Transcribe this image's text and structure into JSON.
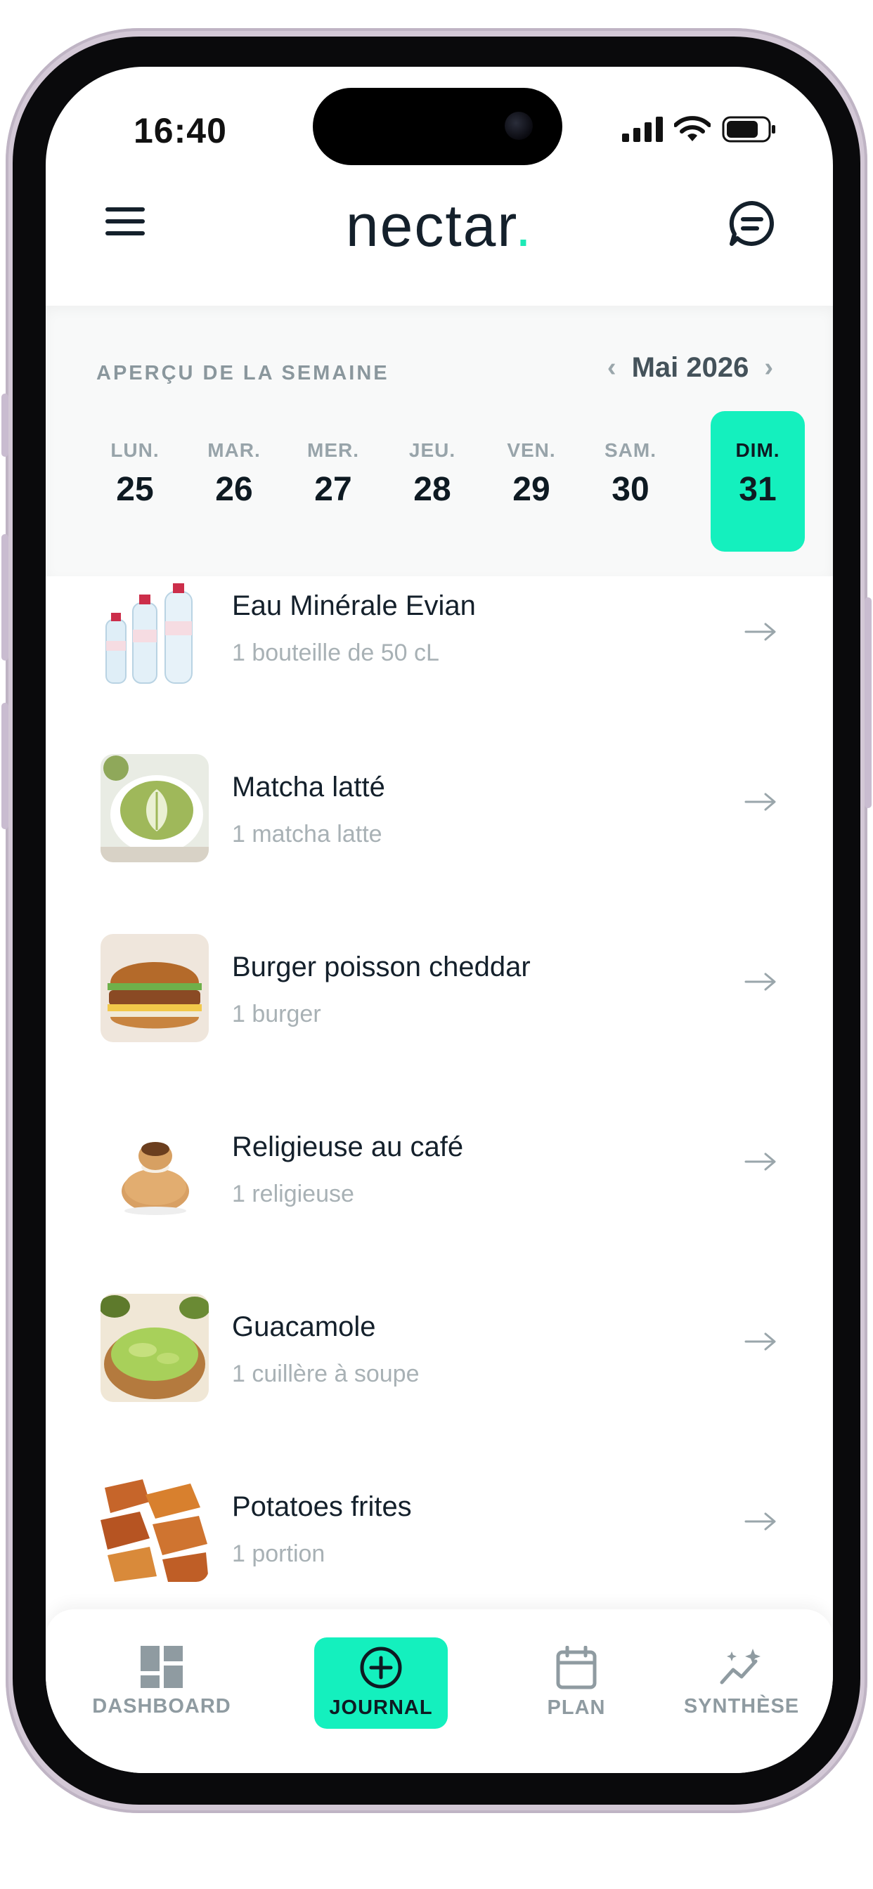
{
  "status_bar": {
    "time": "16:40"
  },
  "header": {
    "logo_text": "nectar",
    "logo_dot": "."
  },
  "week": {
    "title": "APERÇU DE LA SEMAINE",
    "month": "Mai 2026",
    "prev_glyph": "‹",
    "next_glyph": "›",
    "days": [
      {
        "name": "LUN.",
        "num": "25",
        "active": false
      },
      {
        "name": "MAR.",
        "num": "26",
        "active": false
      },
      {
        "name": "MER.",
        "num": "27",
        "active": false
      },
      {
        "name": "JEU.",
        "num": "28",
        "active": false
      },
      {
        "name": "VEN.",
        "num": "29",
        "active": false
      },
      {
        "name": "SAM.",
        "num": "30",
        "active": false
      },
      {
        "name": "DIM.",
        "num": "31",
        "active": true
      }
    ]
  },
  "foods": [
    {
      "name": "Eau Minérale Evian",
      "qty": "1 bouteille de 50 cL",
      "image": "water-bottles"
    },
    {
      "name": "Matcha latté",
      "qty": "1 matcha latte",
      "image": "matcha-latte"
    },
    {
      "name": "Burger poisson cheddar",
      "qty": "1 burger",
      "image": "burger"
    },
    {
      "name": "Religieuse au café",
      "qty": "1 religieuse",
      "image": "religieuse"
    },
    {
      "name": "Guacamole",
      "qty": "1 cuillère à soupe",
      "image": "guacamole"
    },
    {
      "name": "Potatoes frites",
      "qty": "1 portion",
      "image": "potatoes"
    }
  ],
  "nav": [
    {
      "label": "DASHBOARD",
      "icon": "dashboard-icon",
      "active": false
    },
    {
      "label": "JOURNAL",
      "icon": "plus-circle-icon",
      "active": true
    },
    {
      "label": "PLAN",
      "icon": "calendar-icon",
      "active": false
    },
    {
      "label": "SYNTHÈSE",
      "icon": "chart-sparkle-icon",
      "active": false
    }
  ],
  "colors": {
    "accent": "#14f0be",
    "text_dark": "#14202b",
    "muted": "#a8b1b5"
  }
}
